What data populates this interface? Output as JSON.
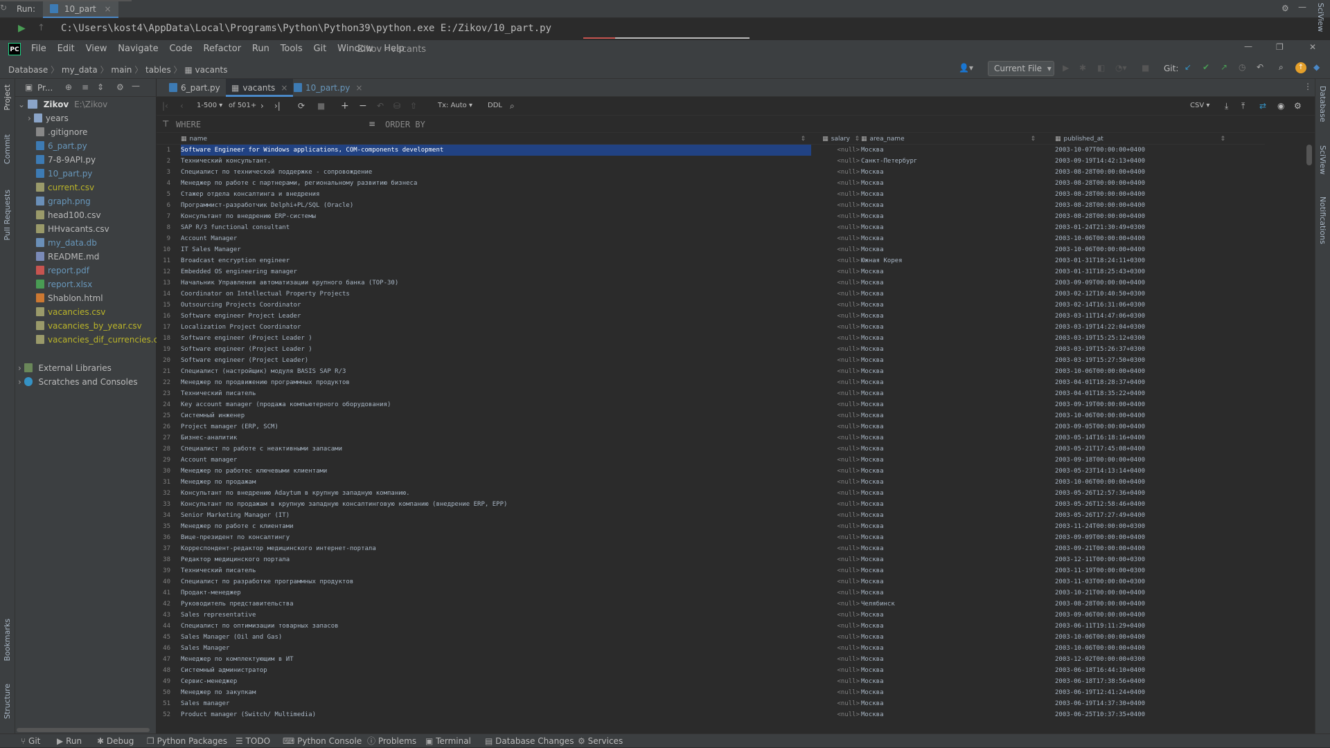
{
  "run_bar": {
    "label": "Run:",
    "tab": "10_part",
    "command": "C:\\Users\\kost4\\AppData\\Local\\Programs\\Python\\Python39\\python.exe E:/Zikov/10_part.py"
  },
  "menu": {
    "items": [
      "File",
      "Edit",
      "View",
      "Navigate",
      "Code",
      "Refactor",
      "Run",
      "Tools",
      "Git",
      "Window",
      "Help"
    ],
    "title": "Zikov - vacants"
  },
  "breadcrumb": [
    "Database",
    "my_data",
    "main",
    "tables",
    "vacants"
  ],
  "toolbar": {
    "run_config": "Current File",
    "git_label": "Git:"
  },
  "project_panel": {
    "title": "Pr...",
    "root": {
      "name": "Zikov",
      "path": "E:\\Zikov"
    },
    "items": [
      {
        "name": "years",
        "type": "folder",
        "color": "#bbbbbb"
      },
      {
        "name": ".gitignore",
        "type": "file",
        "color": "#bbbbbb"
      },
      {
        "name": "6_part.py",
        "type": "py",
        "color": "#6897bb"
      },
      {
        "name": "7-8-9API.py",
        "type": "py",
        "color": "#bbbbbb"
      },
      {
        "name": "10_part.py",
        "type": "py",
        "color": "#6897bb"
      },
      {
        "name": "current.csv",
        "type": "csv",
        "color": "#bbb529"
      },
      {
        "name": "graph.png",
        "type": "img",
        "color": "#6897bb"
      },
      {
        "name": "head100.csv",
        "type": "csv",
        "color": "#bbbbbb"
      },
      {
        "name": "HHvacants.csv",
        "type": "csv",
        "color": "#bbbbbb"
      },
      {
        "name": "my_data.db",
        "type": "db",
        "color": "#6897bb"
      },
      {
        "name": "README.md",
        "type": "md",
        "color": "#bbbbbb"
      },
      {
        "name": "report.pdf",
        "type": "pdf",
        "color": "#6897bb"
      },
      {
        "name": "report.xlsx",
        "type": "xlsx",
        "color": "#6897bb"
      },
      {
        "name": "Shablon.html",
        "type": "html",
        "color": "#bbbbbb"
      },
      {
        "name": "vacancies.csv",
        "type": "csv",
        "color": "#bbb529"
      },
      {
        "name": "vacancies_by_year.csv",
        "type": "csv",
        "color": "#bbb529"
      },
      {
        "name": "vacancies_dif_currencies.cs",
        "type": "csv",
        "color": "#bbb529"
      }
    ],
    "external": "External Libraries",
    "scratches": "Scratches and Consoles"
  },
  "editor_tabs": [
    "6_part.py",
    "vacants",
    "10_part.py"
  ],
  "grid_toolbar": {
    "range": "1-500",
    "of": "of 501+",
    "tx": "Tx: Auto",
    "ddl": "DDL",
    "export": "CSV"
  },
  "filter": {
    "where": "WHERE",
    "order_by": "ORDER BY"
  },
  "columns": [
    "name",
    "salary",
    "area_name",
    "published_at"
  ],
  "rows": [
    [
      "1",
      "Software Engineer for Windows applications, COM-components development",
      "<null>",
      "Москва",
      "2003-10-07T00:00:00+0400"
    ],
    [
      "2",
      "Технический консультант.",
      "<null>",
      "Санкт-Петербург",
      "2003-09-19T14:42:13+0400"
    ],
    [
      "3",
      "Специалист по технической поддержке - сопровождение",
      "<null>",
      "Москва",
      "2003-08-28T00:00:00+0400"
    ],
    [
      "4",
      "Менеджер по работе с партнерами, региональному развитию бизнеса",
      "<null>",
      "Москва",
      "2003-08-28T00:00:00+0400"
    ],
    [
      "5",
      "Стажер отдела консалтинга и внедрения",
      "<null>",
      "Москва",
      "2003-08-28T00:00:00+0400"
    ],
    [
      "6",
      "Программист-разработчик Delphi+PL/SQL (Oracle)",
      "<null>",
      "Москва",
      "2003-08-28T00:00:00+0400"
    ],
    [
      "7",
      "Консультант по внедрению ERP-системы",
      "<null>",
      "Москва",
      "2003-08-28T00:00:00+0400"
    ],
    [
      "8",
      "SAP R/3 functional consultant",
      "<null>",
      "Москва",
      "2003-01-24T21:30:49+0300"
    ],
    [
      "9",
      "Account Manager",
      "<null>",
      "Москва",
      "2003-10-06T00:00:00+0400"
    ],
    [
      "10",
      "IT Sales Manager",
      "<null>",
      "Москва",
      "2003-10-06T00:00:00+0400"
    ],
    [
      "11",
      "Broadcast encryption engineer",
      "<null>",
      "Южная Корея",
      "2003-01-31T18:24:11+0300"
    ],
    [
      "12",
      "Embedded OS engineering manager",
      "<null>",
      "Москва",
      "2003-01-31T18:25:43+0300"
    ],
    [
      "13",
      "Начальник Управления автоматизации крупного банка (TOP-30)",
      "<null>",
      "Москва",
      "2003-09-09T00:00:00+0400"
    ],
    [
      "14",
      "Coordinator on Intellectual Property Projects",
      "<null>",
      "Москва",
      "2003-02-12T10:40:50+0300"
    ],
    [
      "15",
      "Outsourcing Projects Coordinator",
      "<null>",
      "Москва",
      "2003-02-14T16:31:06+0300"
    ],
    [
      "16",
      "Software engineer  Project Leader",
      "<null>",
      "Москва",
      "2003-03-11T14:47:06+0300"
    ],
    [
      "17",
      "Localization Project Coordinator",
      "<null>",
      "Москва",
      "2003-03-19T14:22:04+0300"
    ],
    [
      "18",
      "Software engineer (Project Leader )",
      "<null>",
      "Москва",
      "2003-03-19T15:25:12+0300"
    ],
    [
      "19",
      "Software engineer (Project Leader )",
      "<null>",
      "Москва",
      "2003-03-19T15:26:37+0300"
    ],
    [
      "20",
      "Software engineer  (Project Leader)",
      "<null>",
      "Москва",
      "2003-03-19T15:27:50+0300"
    ],
    [
      "21",
      "Специалист (настройщик) модуля BASIS SAP R/3",
      "<null>",
      "Москва",
      "2003-10-06T00:00:00+0400"
    ],
    [
      "22",
      "Менеджер по продвижению программных продуктов",
      "<null>",
      "Москва",
      "2003-04-01T18:28:37+0400"
    ],
    [
      "23",
      "Технический писатель",
      "<null>",
      "Москва",
      "2003-04-01T18:35:22+0400"
    ],
    [
      "24",
      "Key account manager  (продажа компьютерного оборудования)",
      "<null>",
      "Москва",
      "2003-09-19T00:00:00+0400"
    ],
    [
      "25",
      "Системный инженер",
      "<null>",
      "Москва",
      "2003-10-06T00:00:00+0400"
    ],
    [
      "26",
      "Project manager (ERP, SCM)",
      "<null>",
      "Москва",
      "2003-09-05T00:00:00+0400"
    ],
    [
      "27",
      "Бизнес-аналитик",
      "<null>",
      "Москва",
      "2003-05-14T16:18:16+0400"
    ],
    [
      "28",
      "Специалист по работе с неактивными запасами",
      "<null>",
      "Москва",
      "2003-05-21T17:45:08+0400"
    ],
    [
      "29",
      "Account manager",
      "<null>",
      "Москва",
      "2003-09-18T00:00:00+0400"
    ],
    [
      "30",
      "Менеджер по работес ключевыми клиентами",
      "<null>",
      "Москва",
      "2003-05-23T14:13:14+0400"
    ],
    [
      "31",
      "Менеджер по продажам",
      "<null>",
      "Москва",
      "2003-10-06T00:00:00+0400"
    ],
    [
      "32",
      "Консультант по внедрению Adaytum в крупную западную компанию.",
      "<null>",
      "Москва",
      "2003-05-26T12:57:36+0400"
    ],
    [
      "33",
      "Консультант по продажам в крупную западную консалтинговую компанию (внедрение ERP, EPP)",
      "<null>",
      "Москва",
      "2003-05-26T12:58:46+0400"
    ],
    [
      "34",
      "Senior Marketing Manager (IT)",
      "<null>",
      "Москва",
      "2003-05-26T17:27:49+0400"
    ],
    [
      "35",
      "Менеджер по работе с клиентами",
      "<null>",
      "Москва",
      "2003-11-24T00:00:00+0300"
    ],
    [
      "36",
      "Вице-президент по консалтингу",
      "<null>",
      "Москва",
      "2003-09-09T00:00:00+0400"
    ],
    [
      "37",
      "Корреспондент-редактор медицинского интернет-портала",
      "<null>",
      "Москва",
      "2003-09-21T00:00:00+0400"
    ],
    [
      "38",
      "Редактор медицинского портала",
      "<null>",
      "Москва",
      "2003-12-11T00:00:00+0300"
    ],
    [
      "39",
      "Технический писатель",
      "<null>",
      "Москва",
      "2003-11-19T00:00:00+0300"
    ],
    [
      "40",
      "Специалист по разработке программных продуктов",
      "<null>",
      "Москва",
      "2003-11-03T00:00:00+0300"
    ],
    [
      "41",
      "Продакт-менеджер",
      "<null>",
      "Москва",
      "2003-10-21T00:00:00+0400"
    ],
    [
      "42",
      "Руководитель представительства",
      "<null>",
      "Челябинск",
      "2003-08-28T00:00:00+0400"
    ],
    [
      "43",
      "Sales representative",
      "<null>",
      "Москва",
      "2003-09-06T00:00:00+0400"
    ],
    [
      "44",
      "Специалист по оптимизации товарных запасов",
      "<null>",
      "Москва",
      "2003-06-11T19:11:29+0400"
    ],
    [
      "45",
      "Sales Manager (Oil and Gas)",
      "<null>",
      "Москва",
      "2003-10-06T00:00:00+0400"
    ],
    [
      "46",
      "Sales Manager",
      "<null>",
      "Москва",
      "2003-10-06T00:00:00+0400"
    ],
    [
      "47",
      "Менеджер по комплектующим в ИТ",
      "<null>",
      "Москва",
      "2003-12-02T00:00:00+0300"
    ],
    [
      "48",
      "Системный администратор",
      "<null>",
      "Москва",
      "2003-06-18T16:44:10+0400"
    ],
    [
      "49",
      "Сервис-менеджер",
      "<null>",
      "Москва",
      "2003-06-18T17:38:56+0400"
    ],
    [
      "50",
      "Менеджер по закупкам",
      "<null>",
      "Москва",
      "2003-06-19T12:41:24+0400"
    ],
    [
      "51",
      "Sales manager",
      "<null>",
      "Москва",
      "2003-06-19T14:37:30+0400"
    ],
    [
      "52",
      "Product manager (Switch/ Multimedia)",
      "<null>",
      "Москва",
      "2003-06-25T10:37:35+0400"
    ]
  ],
  "left_tools": [
    "Project",
    "Commit",
    "Pull Requests",
    "Bookmarks",
    "Structure"
  ],
  "right_tools": [
    "Database",
    "SciView",
    "Notifications"
  ],
  "run_right_tool": "SciView",
  "bottom_tools": [
    "Git",
    "Run",
    "Debug",
    "Python Packages",
    "TODO",
    "Python Console",
    "Problems",
    "Terminal",
    "Database Changes",
    "Services"
  ],
  "colors": {
    "accent": "#4a88c7",
    "selection": "#214283",
    "panel": "#3c3f41",
    "editor": "#2b2b2b"
  }
}
